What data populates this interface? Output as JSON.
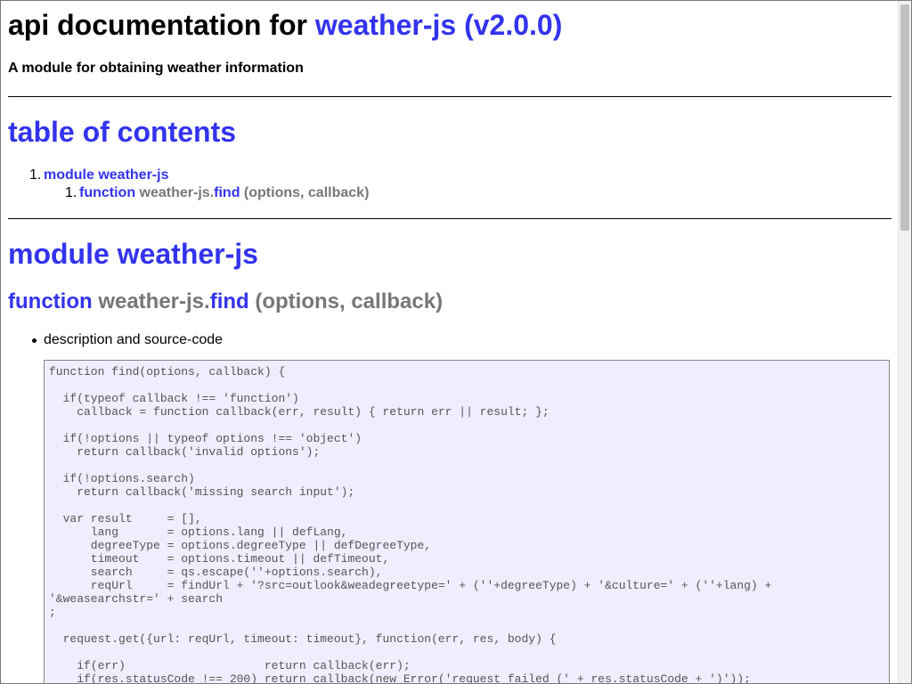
{
  "header": {
    "title_prefix": "api documentation for",
    "title_link": "weather-js (v2.0.0)",
    "description": "A module for obtaining weather information"
  },
  "toc": {
    "heading": "table of contents",
    "items": [
      {
        "number": "1.",
        "label": "module weather-js",
        "children": [
          {
            "number": "1.",
            "keyword": "function",
            "owner": "weather-js.",
            "name": "find",
            "args": "(options, callback)"
          }
        ]
      }
    ]
  },
  "module": {
    "heading": "module weather-js",
    "function": {
      "keyword": "function",
      "owner": "weather-js.",
      "name": "find",
      "args": "(options, callback)"
    },
    "bullets": [
      "description and source-code"
    ],
    "source_code": "function find(options, callback) {\n\n  if(typeof callback !== 'function')\n    callback = function callback(err, result) { return err || result; };\n\n  if(!options || typeof options !== 'object')\n    return callback('invalid options');\n\n  if(!options.search)\n    return callback('missing search input');\n\n  var result     = [],\n      lang       = options.lang || defLang,\n      degreeType = options.degreeType || defDegreeType,\n      timeout    = options.timeout || defTimeout,\n      search     = qs.escape(''+options.search),\n      reqUrl     = findUrl + '?src=outlook&weadegreetype=' + (''+degreeType) + '&culture=' + (''+lang) +\n'&weasearchstr=' + search\n;\n\n  request.get({url: reqUrl, timeout: timeout}, function(err, res, body) {\n\n    if(err)                    return callback(err);\n    if(res.statusCode !== 200) return callback(new Error('request failed (' + res.statusCode + ')'));"
  },
  "colors": {
    "link": "#3333ee",
    "muted": "#777777",
    "code_background": "#eeeeff",
    "code_text": "#555555"
  }
}
